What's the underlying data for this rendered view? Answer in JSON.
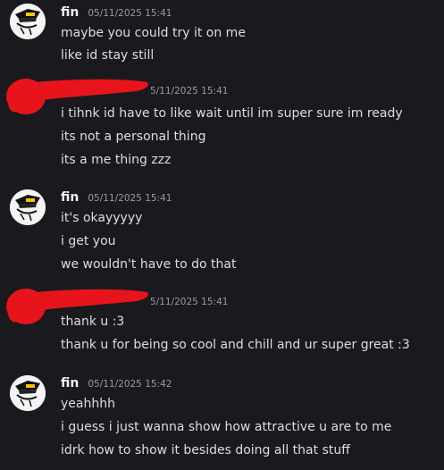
{
  "messages": [
    {
      "author": "fin",
      "timestamp": "05/11/2025 15:41",
      "redacted": false,
      "lines": [
        "maybe you could try it on me",
        "like id stay still"
      ]
    },
    {
      "author": "",
      "timestamp": "5/11/2025 15:41",
      "redacted": true,
      "lines": [
        "i tihnk id have to like wait until im super sure im ready",
        "its not a personal thing",
        "its a me thing zzz"
      ]
    },
    {
      "author": "fin",
      "timestamp": "05/11/2025 15:41",
      "redacted": false,
      "lines": [
        "it's okayyyyy",
        "i get you",
        "we wouldn't have to do that"
      ]
    },
    {
      "author": "",
      "timestamp": "5/11/2025 15:41",
      "redacted": true,
      "lines": [
        "thank u :3",
        "thank u for being so cool and chill and ur super great :3"
      ]
    },
    {
      "author": "fin",
      "timestamp": "05/11/2025 15:42",
      "redacted": false,
      "lines": [
        "yeahhhh",
        "i guess i just wanna show how attractive u are to me",
        "idrk how to show it besides doing all that stuff"
      ]
    }
  ],
  "colors": {
    "background": "#1a1a1e",
    "text": "#dbdee1",
    "username": "#f2f3f5",
    "timestamp": "#949ba4",
    "redaction": "#e8141b"
  },
  "icons": {
    "avatar": "cartoon-face-with-sunglasses-icon",
    "redaction": "red-scribble-redaction"
  }
}
